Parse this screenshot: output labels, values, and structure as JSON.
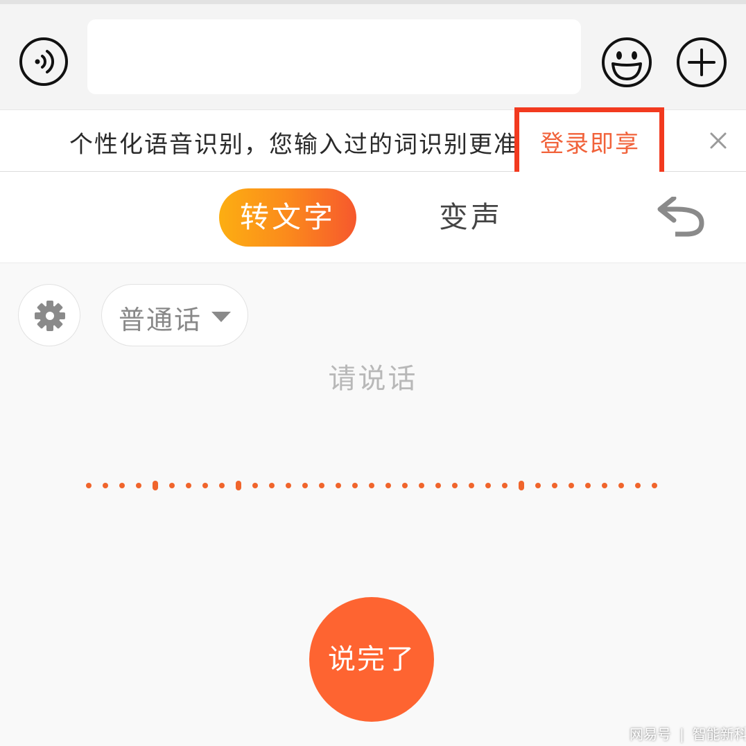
{
  "input_bar": {
    "voice_icon": "voice-wave-icon",
    "text_value": "",
    "emoji_icon": "smiley-icon",
    "plus_icon": "plus-circle-icon"
  },
  "banner": {
    "text": "个性化语音识别，您输入过的词识别更准",
    "login_link": "登录即享",
    "close_icon": "close-icon",
    "highlight_color": "#f23a1f"
  },
  "tabs": {
    "items": [
      {
        "label": "转文字",
        "active": true
      },
      {
        "label": "变声",
        "active": false
      }
    ],
    "undo_icon": "undo-arrow-icon"
  },
  "controls": {
    "settings_icon": "gear-icon",
    "language": "普通话",
    "caret_icon": "caret-down-icon"
  },
  "prompt": "请说话",
  "waveform": {
    "dots": 35,
    "tall_dot_indexes": [
      4,
      9,
      26
    ],
    "color": "#f0652c"
  },
  "done_button": "说完了",
  "watermark": {
    "brand": "网易号",
    "author": "智能新科"
  },
  "colors": {
    "accent_orange": "#fe6431",
    "tab_gradient_start": "#fcae12",
    "tab_gradient_end": "#f6582d",
    "link_orange": "#f1623a"
  }
}
